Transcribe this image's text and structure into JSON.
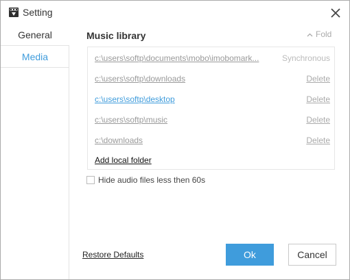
{
  "window": {
    "title": "Setting"
  },
  "sidebar": {
    "tabs": [
      {
        "label": "General"
      },
      {
        "label": "Media"
      }
    ]
  },
  "music_library": {
    "title": "Music library",
    "fold_label": "Fold",
    "folders": [
      {
        "path": "c:\\users\\softp\\documents\\mobo\\imobomark...",
        "action": "Synchronous"
      },
      {
        "path": "c:\\users\\softp\\downloads",
        "action": "Delete"
      },
      {
        "path": "c:\\users\\softp\\desktop",
        "action": "Delete"
      },
      {
        "path": "c:\\users\\softp\\music",
        "action": "Delete"
      },
      {
        "path": "c:\\downloads",
        "action": "Delete"
      }
    ],
    "add_folder_label": "Add local folder"
  },
  "options": {
    "hide_short_audio_label": "Hide audio files less then 60s"
  },
  "footer": {
    "restore_label": "Restore Defaults",
    "ok_label": "Ok",
    "cancel_label": "Cancel"
  },
  "colors": {
    "accent": "#3f9cdc",
    "muted_text": "#999999",
    "border": "#e3e3e3"
  }
}
